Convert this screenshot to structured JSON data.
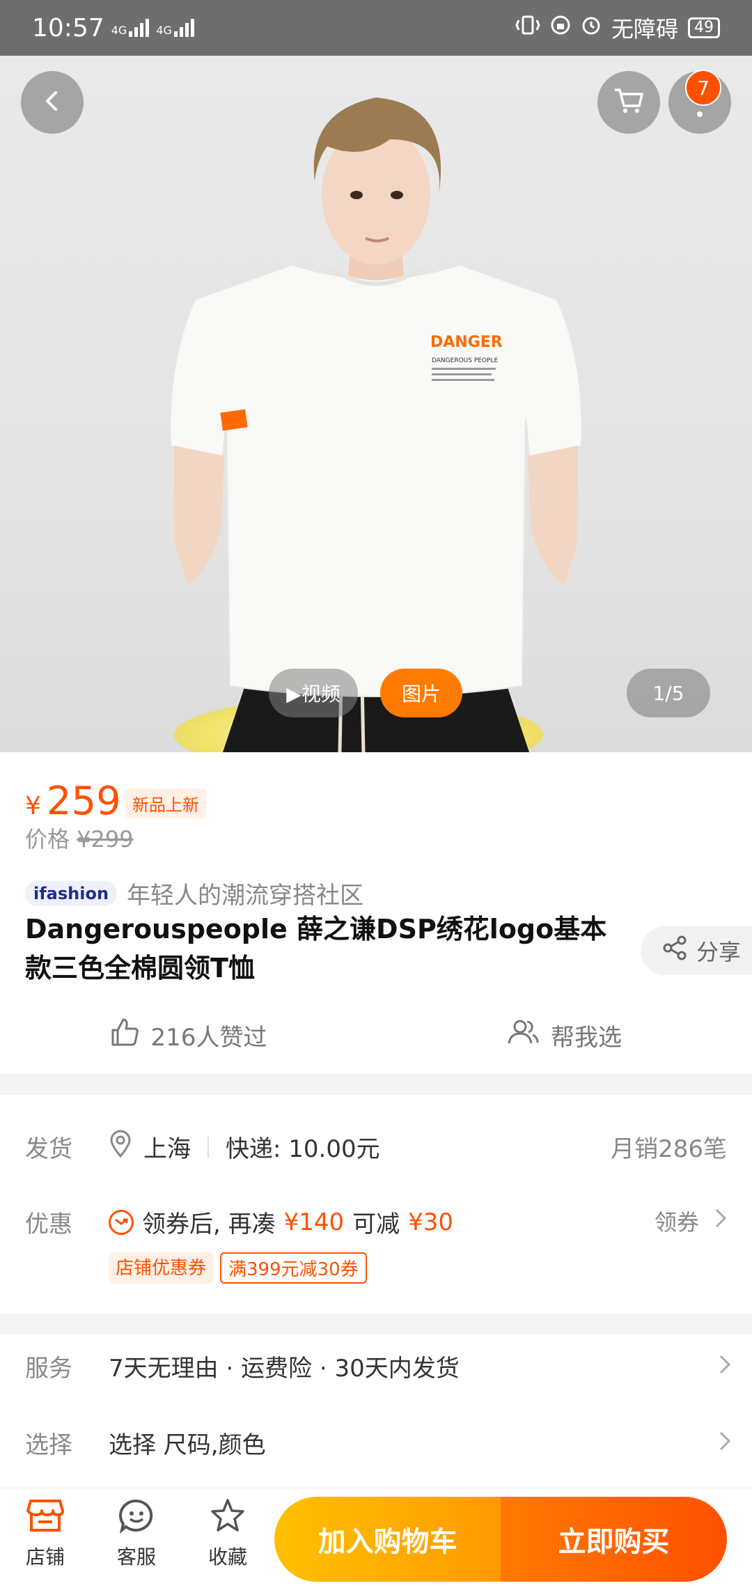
{
  "status_bar": {
    "time": "10:57",
    "network1": "4G",
    "network2": "4G",
    "accessibility": "无障碍",
    "battery": "49"
  },
  "hero": {
    "cart_badge_count": "7",
    "tab_video": "▶视频",
    "tab_photo": "图片",
    "counter": "1/5",
    "shirt_print_logo": "DANGER",
    "shirt_print_text": "DANGEROUS PEOPLE"
  },
  "price": {
    "currency": "¥",
    "current": "259",
    "new_tag": "新品上新",
    "original_label": "价格",
    "original_currency": "¥",
    "original_value": "299"
  },
  "brand": {
    "logo_text": "ifashion",
    "slogan": "年轻人的潮流穿搭社区"
  },
  "product": {
    "title": "Dangerouspeople 薛之谦DSP绣花logo基本款三色全棉圆领T恤",
    "share_label": "分享",
    "likes_label": "216人赞过",
    "help_choose_label": "帮我选"
  },
  "shipping": {
    "label": "发货",
    "location": "上海",
    "express": "快递: 10.00元",
    "monthly_sales": "月销286笔"
  },
  "promo": {
    "label": "优惠",
    "text_prefix": "领券后, 再凑",
    "amount_needed": "¥140",
    "text_mid": "可减",
    "amount_off": "¥30",
    "get_coupon": "领券",
    "tag_shop": "店铺优惠券",
    "tag_rule": "满399元减30券"
  },
  "service": {
    "label": "服务",
    "value": "7天无理由 · 运费险 · 30天内发货"
  },
  "select": {
    "label": "选择",
    "value": "选择 尺码,颜色"
  },
  "bottom_bar": {
    "shop": "店铺",
    "service": "客服",
    "favorite": "收藏",
    "add_to_cart": "加入购物车",
    "buy_now": "立即购买"
  },
  "colors": {
    "accent": "#ff5000",
    "cart_button": "#ffb000",
    "buy_button": "#ff6a00"
  }
}
